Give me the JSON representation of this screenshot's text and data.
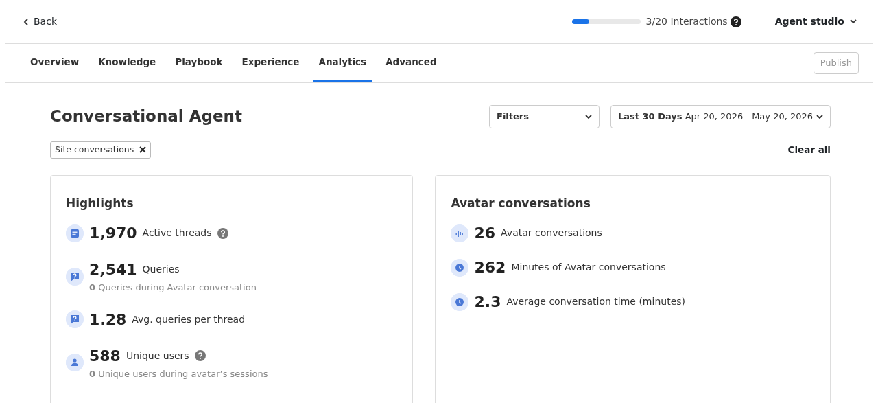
{
  "back": {
    "label": "Back"
  },
  "usage": {
    "level": 0.25,
    "label": "3/20 Interactions"
  },
  "workspace": {
    "label": "Agent studio"
  },
  "tabs": [
    {
      "label": "Overview",
      "selected": false
    },
    {
      "label": "Knowledge",
      "selected": false
    },
    {
      "label": "Playbook",
      "selected": false
    },
    {
      "label": "Experience",
      "selected": false
    },
    {
      "label": "Analytics",
      "selected": true
    },
    {
      "label": "Advanced",
      "selected": false
    }
  ],
  "publish": {
    "label": "Publish",
    "disabled": true
  },
  "title": "Conversational Agent",
  "filters": {
    "label": "Filters"
  },
  "date_range": {
    "preset": "Last 30 Days",
    "range": "Apr 20, 2026 - May 20, 2026"
  },
  "chips": [
    {
      "label": "Site conversations"
    }
  ],
  "clear_all": "Clear all",
  "cards": [
    {
      "title": "Highlights",
      "metrics": [
        {
          "kind": "thread",
          "value": "1,970",
          "label": "Active threads",
          "help": true
        },
        {
          "kind": "query",
          "value": "2,541",
          "label": "Queries",
          "help": false,
          "sub": "**0** Queries during Avatar conversation"
        },
        {
          "kind": "query",
          "value": "1.28",
          "label": "Avg. queries per thread",
          "help": false
        },
        {
          "kind": "user",
          "value": "588",
          "label": "Unique users",
          "help": true,
          "sub": "**0** Unique users during avatar’s sessions"
        }
      ]
    },
    {
      "title": "Avatar conversations",
      "metrics": [
        {
          "kind": "wave",
          "value": "26",
          "label": "Avatar conversations",
          "help": false
        },
        {
          "kind": "clock",
          "value": "262",
          "label": "Minutes of Avatar conversations",
          "help": false
        },
        {
          "kind": "clock",
          "value": "2.3",
          "label": "Average conversation time (minutes)",
          "help": false
        }
      ]
    }
  ]
}
